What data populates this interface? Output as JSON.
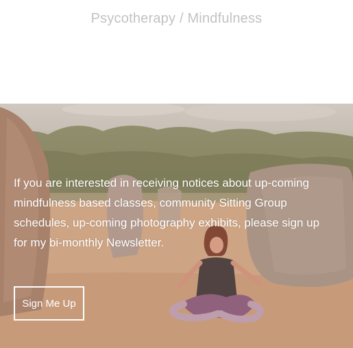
{
  "header": {
    "subtitle": "Psycotherapy / Mindfulness"
  },
  "hero": {
    "newsletter_text": "If you are interested in receiving notices about up-coming mindfulness based classes, community Sitting Group schedules, up-coming photography exhibits, please sign up for my bi-monthly Newsletter.",
    "signup_label": "Sign Me Up",
    "image_description_icon": "meditation-photo"
  },
  "colors": {
    "subtitle": "#c2c2c2",
    "hero_text": "#ffffff",
    "hero_tint": "#c9a084"
  }
}
